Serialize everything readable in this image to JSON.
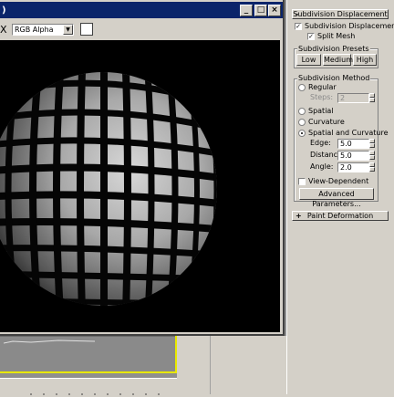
{
  "frame_window": {
    "title": ")",
    "close_glyph": "X",
    "channel_select": "RGB Alpha",
    "minimize_glyph": "_",
    "maximize_glyph": "□",
    "close_btn_glyph": "×"
  },
  "panel": {
    "subdivision_displacement_rollout": {
      "toggle": "-",
      "title": "Subdivision Displacement",
      "subdivision_displacement_label": "Subdivision Displacement",
      "subdivision_displacement_checked": true,
      "split_mesh_label": "Split Mesh",
      "split_mesh_checked": true,
      "presets_group": "Subdivision Presets",
      "presets": [
        "Low",
        "Medium",
        "High"
      ],
      "method_group": "Subdivision Method",
      "regular_label": "Regular",
      "steps_label": "Steps:",
      "steps_value": "2",
      "spatial_label": "Spatial",
      "curvature_label": "Curvature",
      "spatial_curvature_label": "Spatial and Curvature",
      "selected_method": "Spatial and Curvature",
      "edge_label": "Edge:",
      "edge_value": "5.0",
      "distance_label": "Distance:",
      "distance_value": "5.0",
      "angle_label": "Angle:",
      "angle_value": "2.0",
      "view_dependent_label": "View-Dependent",
      "view_dependent_checked": false,
      "advanced_button": "Advanced Parameters..."
    },
    "paint_deformation_rollout": {
      "toggle": "+",
      "title": "Paint Deformation"
    }
  }
}
